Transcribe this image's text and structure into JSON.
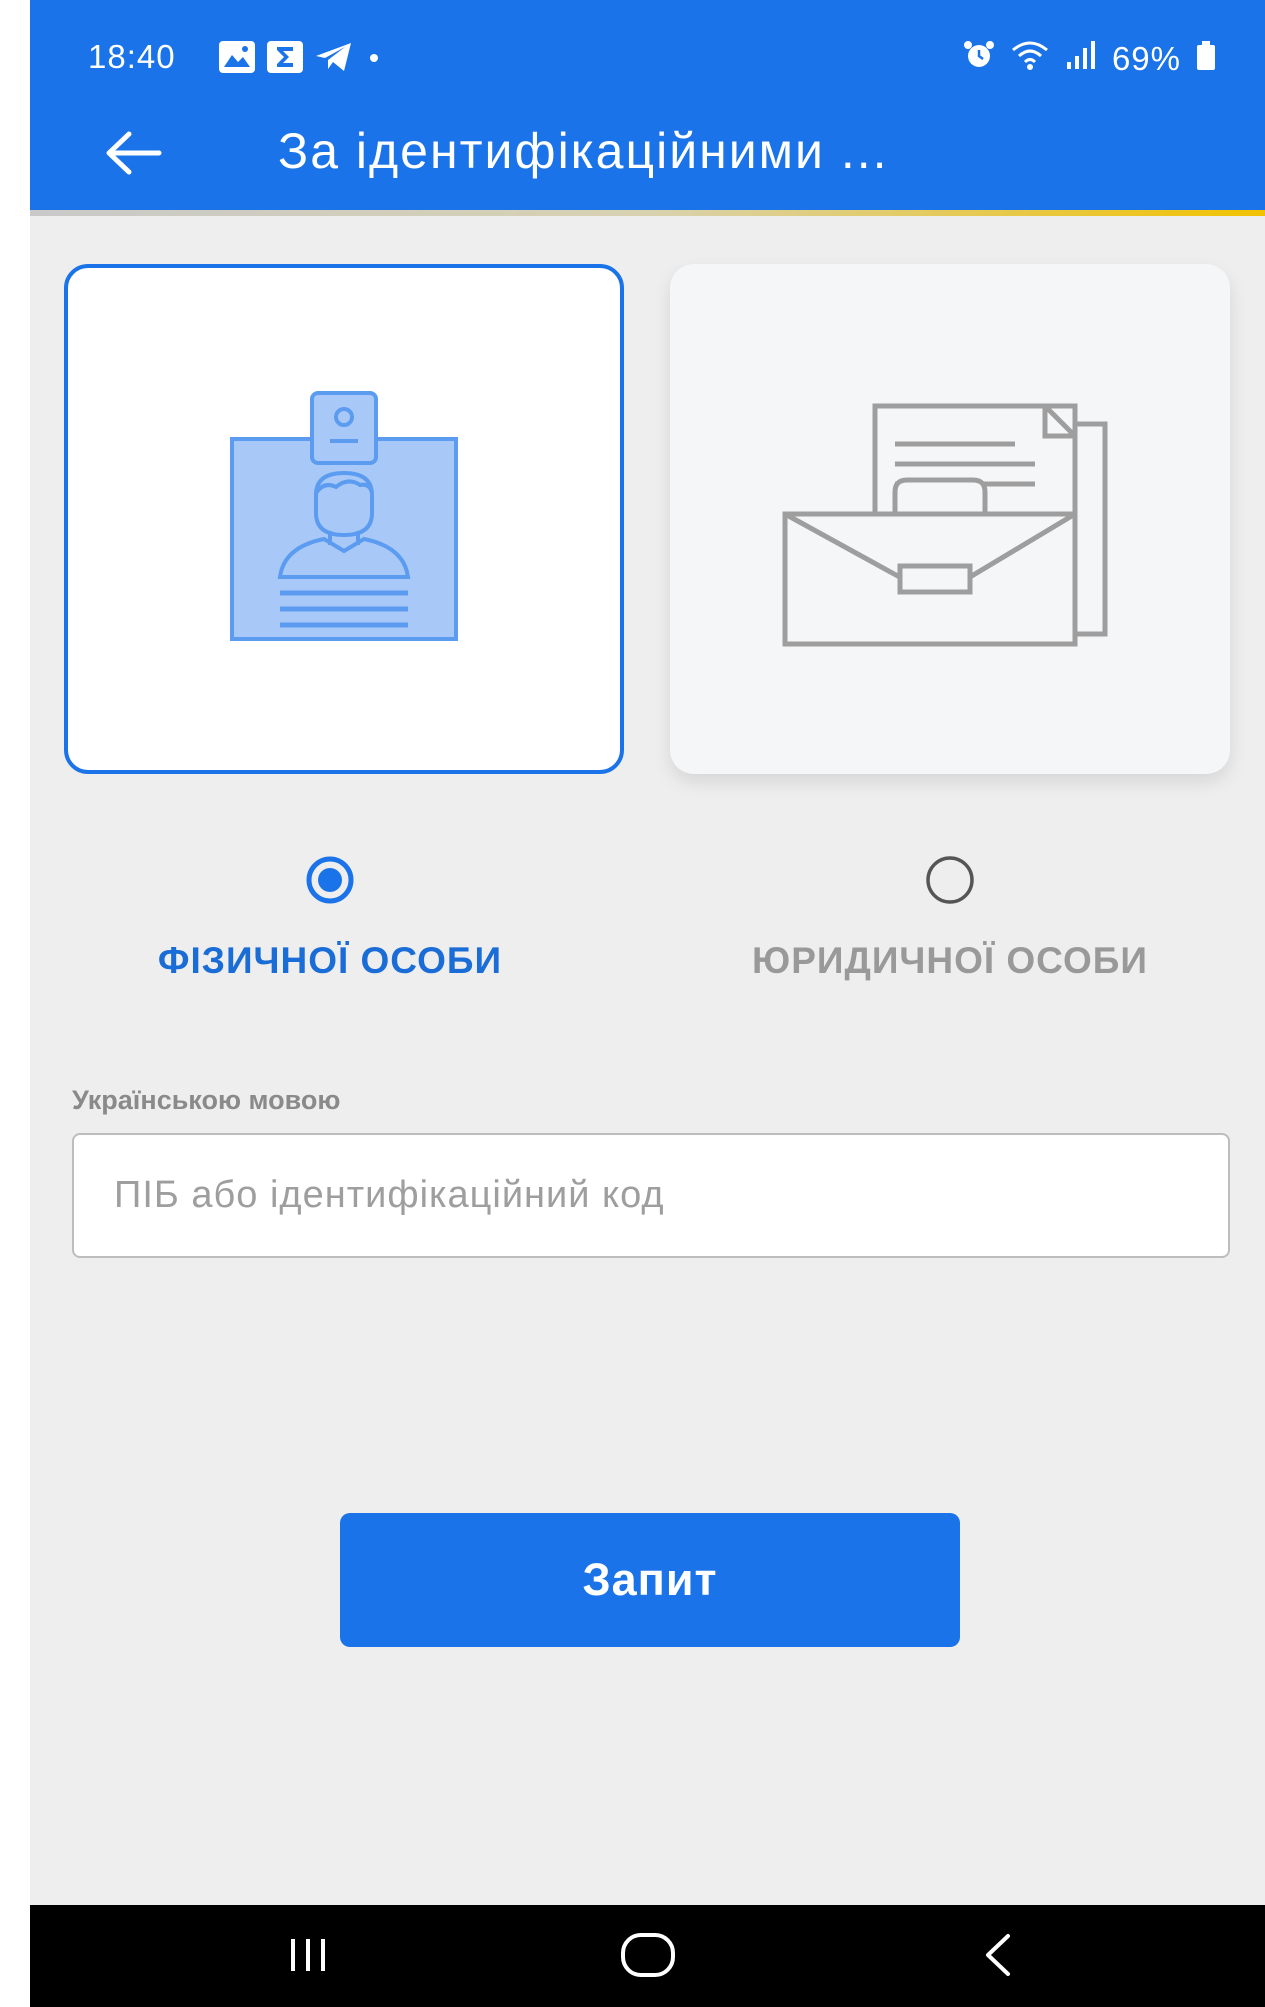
{
  "status_bar": {
    "time": "18:40",
    "battery": "69%"
  },
  "header": {
    "title": "За ідентифікаційними ..."
  },
  "options": [
    {
      "label": "ФІЗИЧНОЇ ОСОБИ",
      "selected": true
    },
    {
      "label": "ЮРИДИЧНОЇ ОСОБИ",
      "selected": false
    }
  ],
  "form": {
    "label": "Українською мовою",
    "placeholder": "ПІБ або ідентифікаційний код",
    "value": ""
  },
  "submit": {
    "label": "Запит"
  },
  "icons": {
    "person_card": "id-badge-icon",
    "company_card": "briefcase-documents-icon"
  },
  "colors": {
    "primary": "#1a73e8",
    "background": "#eeeeee",
    "inactive": "#999999"
  }
}
